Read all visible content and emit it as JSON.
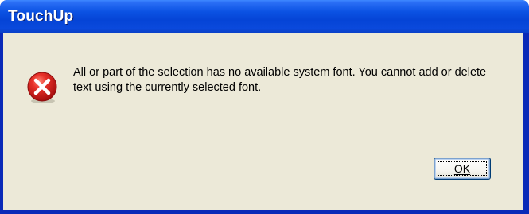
{
  "window": {
    "title": "TouchUp"
  },
  "dialog": {
    "icon": "error-icon",
    "message": "All or part of the selection has no available system font. You cannot add or delete text using the currently selected font.",
    "buttons": {
      "ok_label": "OK"
    }
  },
  "colors": {
    "titlebar": "#0544d6",
    "frame": "#0a2ab8",
    "client": "#ece9d8",
    "error_red": "#d11b1b"
  }
}
